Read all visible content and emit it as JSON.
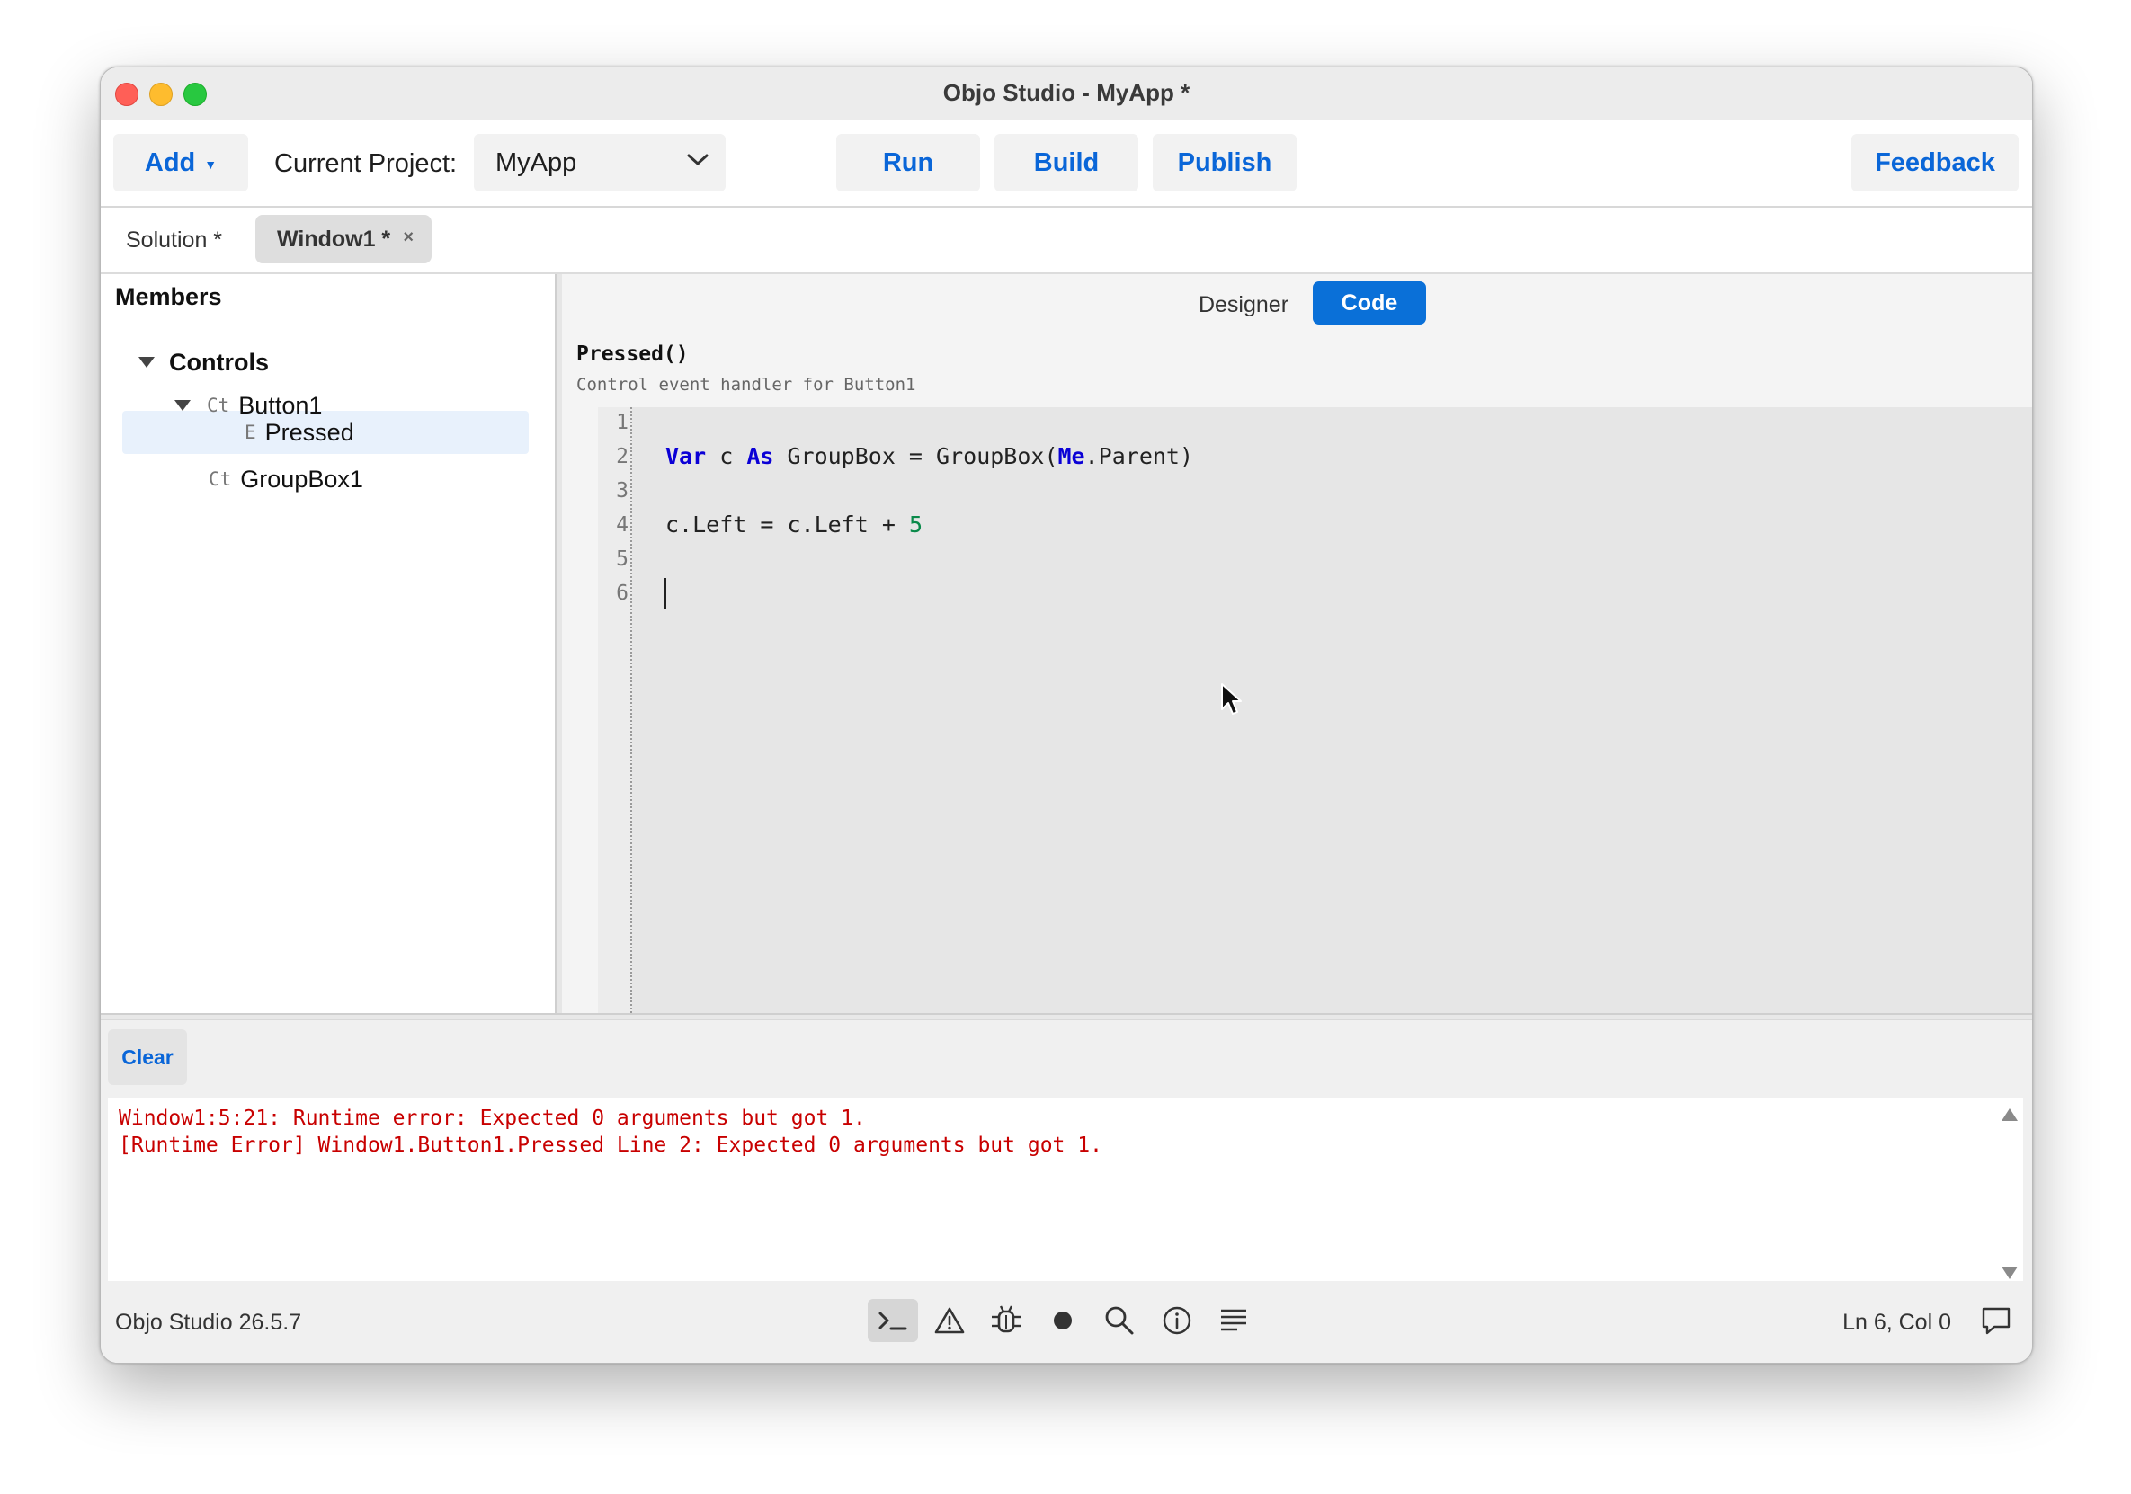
{
  "window": {
    "title": "Objo Studio - MyApp *"
  },
  "toolbar": {
    "add_label": "Add",
    "current_project_label": "Current Project:",
    "project_value": "MyApp",
    "run_label": "Run",
    "build_label": "Build",
    "publish_label": "Publish",
    "feedback_label": "Feedback"
  },
  "tabs": [
    {
      "label": "Solution *"
    },
    {
      "label": "Window1 *",
      "close": "×"
    }
  ],
  "members": {
    "title": "Members",
    "tree": [
      {
        "kind": "",
        "label": "Controls"
      },
      {
        "kind": "Ct",
        "label": "Button1"
      },
      {
        "kind": "E",
        "label": "Pressed"
      },
      {
        "kind": "Ct",
        "label": "GroupBox1"
      }
    ]
  },
  "editor": {
    "view_designer": "Designer",
    "view_code": "Code",
    "method_signature": "Pressed()",
    "method_description": "Control event handler for Button1",
    "line_numbers": [
      "1",
      "2",
      "3",
      "4",
      "5",
      "6"
    ],
    "code": {
      "line2": {
        "kw1": "Var",
        "t1": " c ",
        "kw2": "As",
        "t2": " GroupBox = GroupBox(",
        "kw3": "Me",
        "t3": ".Parent)"
      },
      "line4": {
        "t1": "c.Left = c.Left + ",
        "num": "5"
      }
    }
  },
  "console": {
    "clear_label": "Clear",
    "lines": [
      "Window1:5:21: Runtime error: Expected 0 arguments but got 1.",
      "[Runtime Error] Window1.Button1.Pressed Line 2: Expected 0 arguments but got 1."
    ]
  },
  "statusbar": {
    "version": "Objo Studio 26.5.7",
    "position": "Ln 6, Col 0",
    "icons": [
      "terminal-icon",
      "warning-icon",
      "debug-icon",
      "record-icon",
      "search-icon",
      "info-icon",
      "list-icon",
      "chat-icon"
    ]
  },
  "colors": {
    "accent": "#0a70d8",
    "link": "#0a66d8",
    "error": "#c80000",
    "keyword": "#0b00d6",
    "number": "#0a8a4a"
  }
}
